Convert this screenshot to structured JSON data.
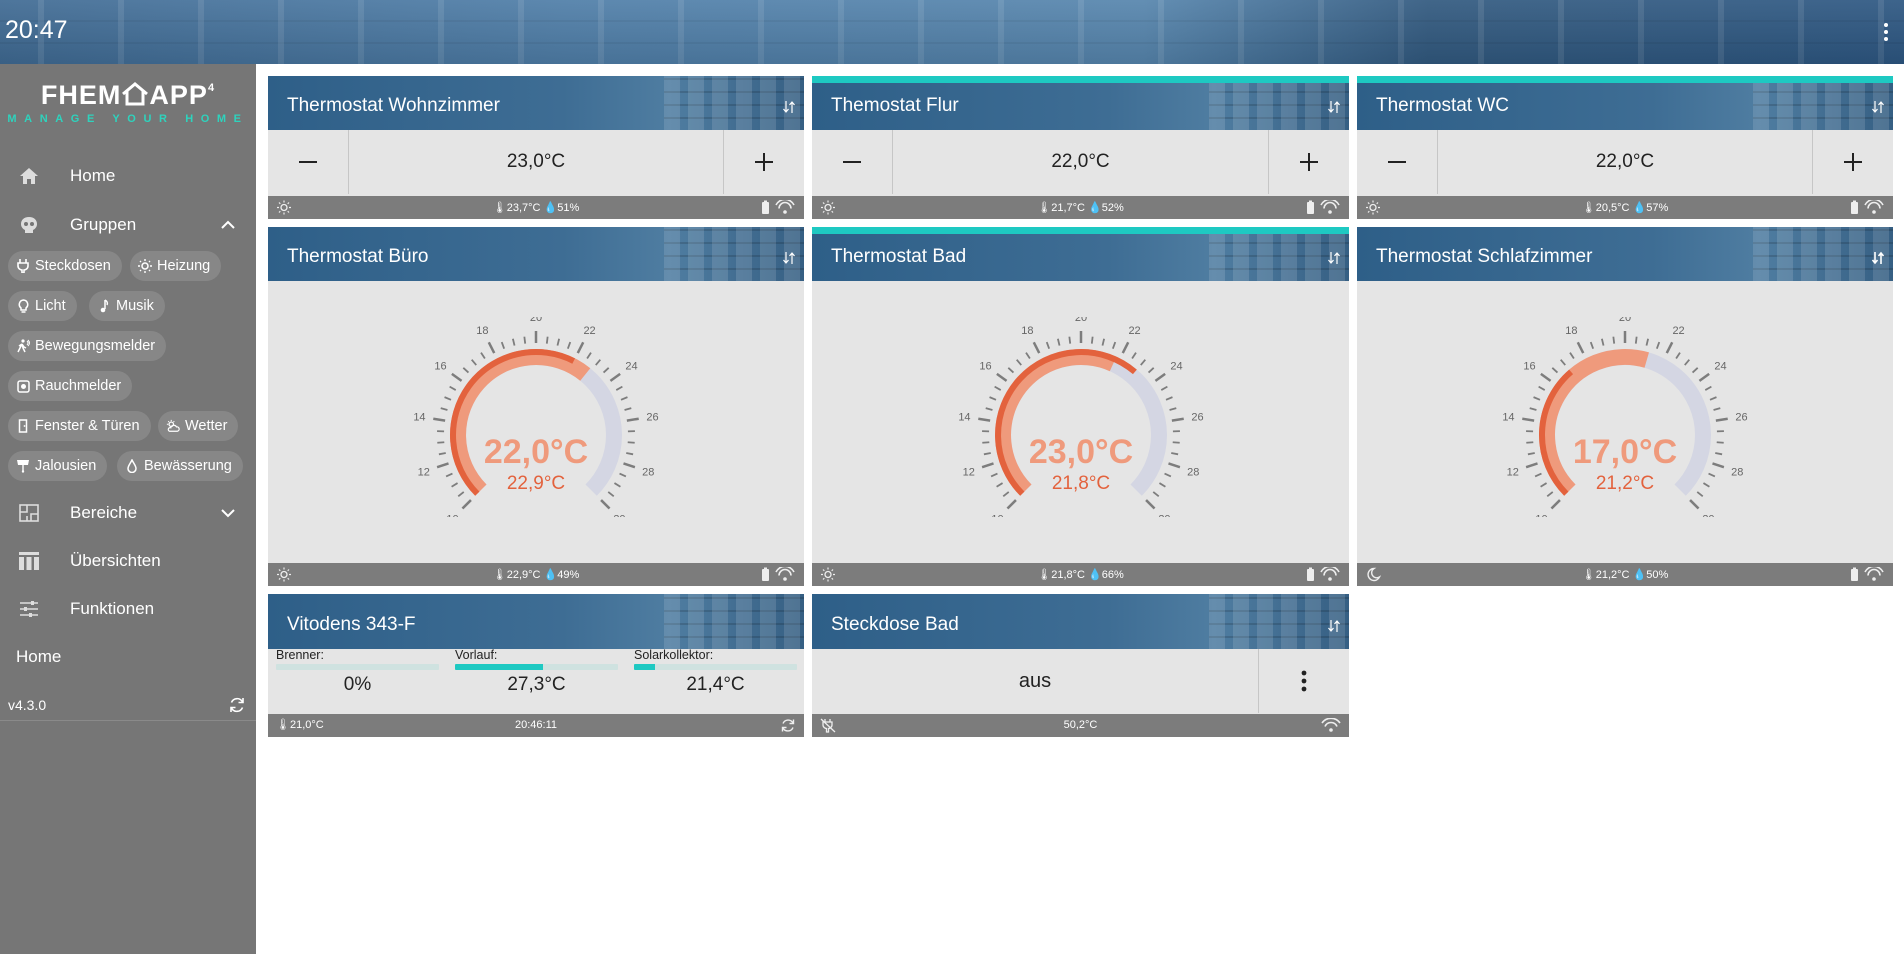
{
  "topbar": {
    "time": "20:47"
  },
  "logo": {
    "main": "FHEM",
    "suffix": "APP",
    "version_mark": "4",
    "tagline": "MANAGE YOUR HOME"
  },
  "sidebar": {
    "home": "Home",
    "groups": "Gruppen",
    "chips": [
      {
        "label": "Steckdosen",
        "icon": "plug-icon"
      },
      {
        "label": "Heizung",
        "icon": "heating-icon"
      },
      {
        "label": "Licht",
        "icon": "bulb-icon"
      },
      {
        "label": "Musik",
        "icon": "music-icon"
      },
      {
        "label": "Bewegungsmelder",
        "icon": "walking-icon"
      },
      {
        "label": "Rauchmelder",
        "icon": "smoke-detector-icon"
      },
      {
        "label": "Fenster & Türen",
        "icon": "door-icon"
      },
      {
        "label": "Wetter",
        "icon": "weather-icon"
      },
      {
        "label": "Jalousien",
        "icon": "blinds-icon"
      },
      {
        "label": "Bewässerung",
        "icon": "water-drop-icon"
      }
    ],
    "areas": "Bereiche",
    "overviews": "Übersichten",
    "functions": "Funktionen",
    "home2": "Home",
    "version": "v4.3.0"
  },
  "colors": {
    "accent": "#1ec9c2",
    "gauge_orange": "#e3623d",
    "gauge_light": "#ef9a7c",
    "gauge_track": "#d4d6e3",
    "footer": "#7c7c7c",
    "sidebar": "#767676"
  },
  "cards": {
    "wohnzimmer": {
      "title": "Thermostat Wohnzimmer",
      "setpoint": "23,0°C",
      "temp": "23,7°C",
      "humidity": "51%",
      "mode_icon": "sun-icon"
    },
    "flur": {
      "title": "Themostat Flur",
      "setpoint": "22,0°C",
      "temp": "21,7°C",
      "humidity": "52%",
      "mode_icon": "sun-icon"
    },
    "wc": {
      "title": "Thermostat WC",
      "setpoint": "22,0°C",
      "temp": "20,5°C",
      "humidity": "57%",
      "mode_icon": "sun-icon"
    },
    "buero": {
      "title": "Thermostat Büro",
      "desired": "22,0°C",
      "actual": "22,9°C",
      "desired_value": 22.0,
      "actual_value": 22.9,
      "temp": "22,9°C",
      "humidity": "49%",
      "mode_icon": "sun-icon"
    },
    "bad": {
      "title": "Thermostat Bad",
      "desired": "23,0°C",
      "actual": "21,8°C",
      "desired_value": 23.0,
      "actual_value": 21.8,
      "temp": "21,8°C",
      "humidity": "66%",
      "mode_icon": "sun-icon"
    },
    "schlafzimmer": {
      "title": "Thermostat Schlafzimmer",
      "desired": "17,0°C",
      "actual": "21,2°C",
      "desired_value": 17.0,
      "actual_value": 21.2,
      "temp": "21,2°C",
      "humidity": "50%",
      "mode_icon": "moon-icon"
    },
    "vitodens": {
      "title": "Vitodens 343-F",
      "items": [
        {
          "label": "Brenner:",
          "value": "0%",
          "level": 0.0
        },
        {
          "label": "Vorlauf:",
          "value": "27,3°C",
          "level": 0.54
        },
        {
          "label": "Solarkollektor:",
          "value": "21,4°C",
          "level": 0.13
        }
      ],
      "temp": "21,0°C",
      "time": "20:46:11"
    },
    "steckdose": {
      "title": "Steckdose Bad",
      "state": "aus",
      "temp": "50,2°C"
    }
  },
  "gauge_scale": {
    "min": 10,
    "max": 30,
    "ticks": [
      "10",
      "12",
      "14",
      "16",
      "18",
      "20",
      "22",
      "24",
      "26",
      "28",
      "30"
    ]
  }
}
